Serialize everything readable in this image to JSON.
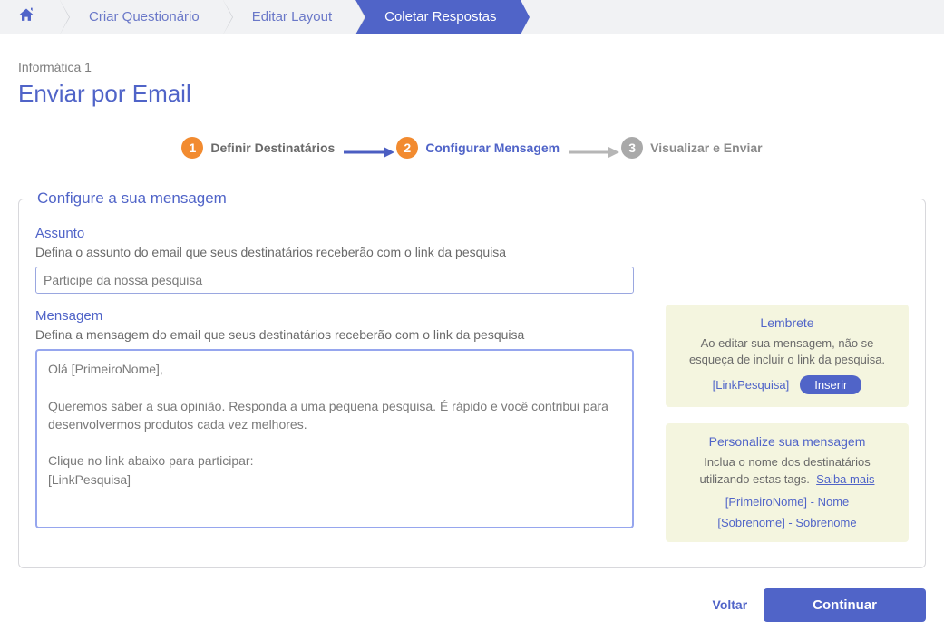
{
  "breadcrumb": {
    "home": "Início",
    "items": [
      {
        "label": "Criar Questionário"
      },
      {
        "label": "Editar Layout"
      },
      {
        "label": "Coletar Respostas"
      }
    ]
  },
  "survey_name": "Informática 1",
  "page_title": "Enviar por Email",
  "steps": [
    {
      "num": "1",
      "label": "Definir Destinatários"
    },
    {
      "num": "2",
      "label": "Configurar Mensagem"
    },
    {
      "num": "3",
      "label": "Visualizar e Enviar"
    }
  ],
  "panel_legend": "Configure a sua mensagem",
  "subject": {
    "title": "Assunto",
    "desc": "Defina o assunto do email que seus destinatários receberão com o link da pesquisa",
    "value": "Participe da nossa pesquisa"
  },
  "message": {
    "title": "Mensagem",
    "desc": "Defina a mensagem do email que seus destinatários receberão com o link da pesquisa",
    "value": "Olá [PrimeiroNome],\n\nQueremos saber a sua opinião. Responda a uma pequena pesquisa. É rápido e você contribui para desenvolvermos produtos cada vez melhores.\n\nClique no link abaixo para participar:\n[LinkPesquisa]"
  },
  "callout_link": {
    "title": "Lembrete",
    "text": "Ao editar sua mensagem, não se esqueça de incluir o link da pesquisa.",
    "tag": "[LinkPesquisa]",
    "insert": "Inserir"
  },
  "callout_personalize": {
    "title": "Personalize sua mensagem",
    "text": "Inclua o nome dos destinatários utilizando estas tags.",
    "learn_more": "Saiba mais",
    "tag1": "[PrimeiroNome] - Nome",
    "tag2": "[Sobrenome] - Sobrenome"
  },
  "actions": {
    "back": "Voltar",
    "continue": "Continuar"
  }
}
